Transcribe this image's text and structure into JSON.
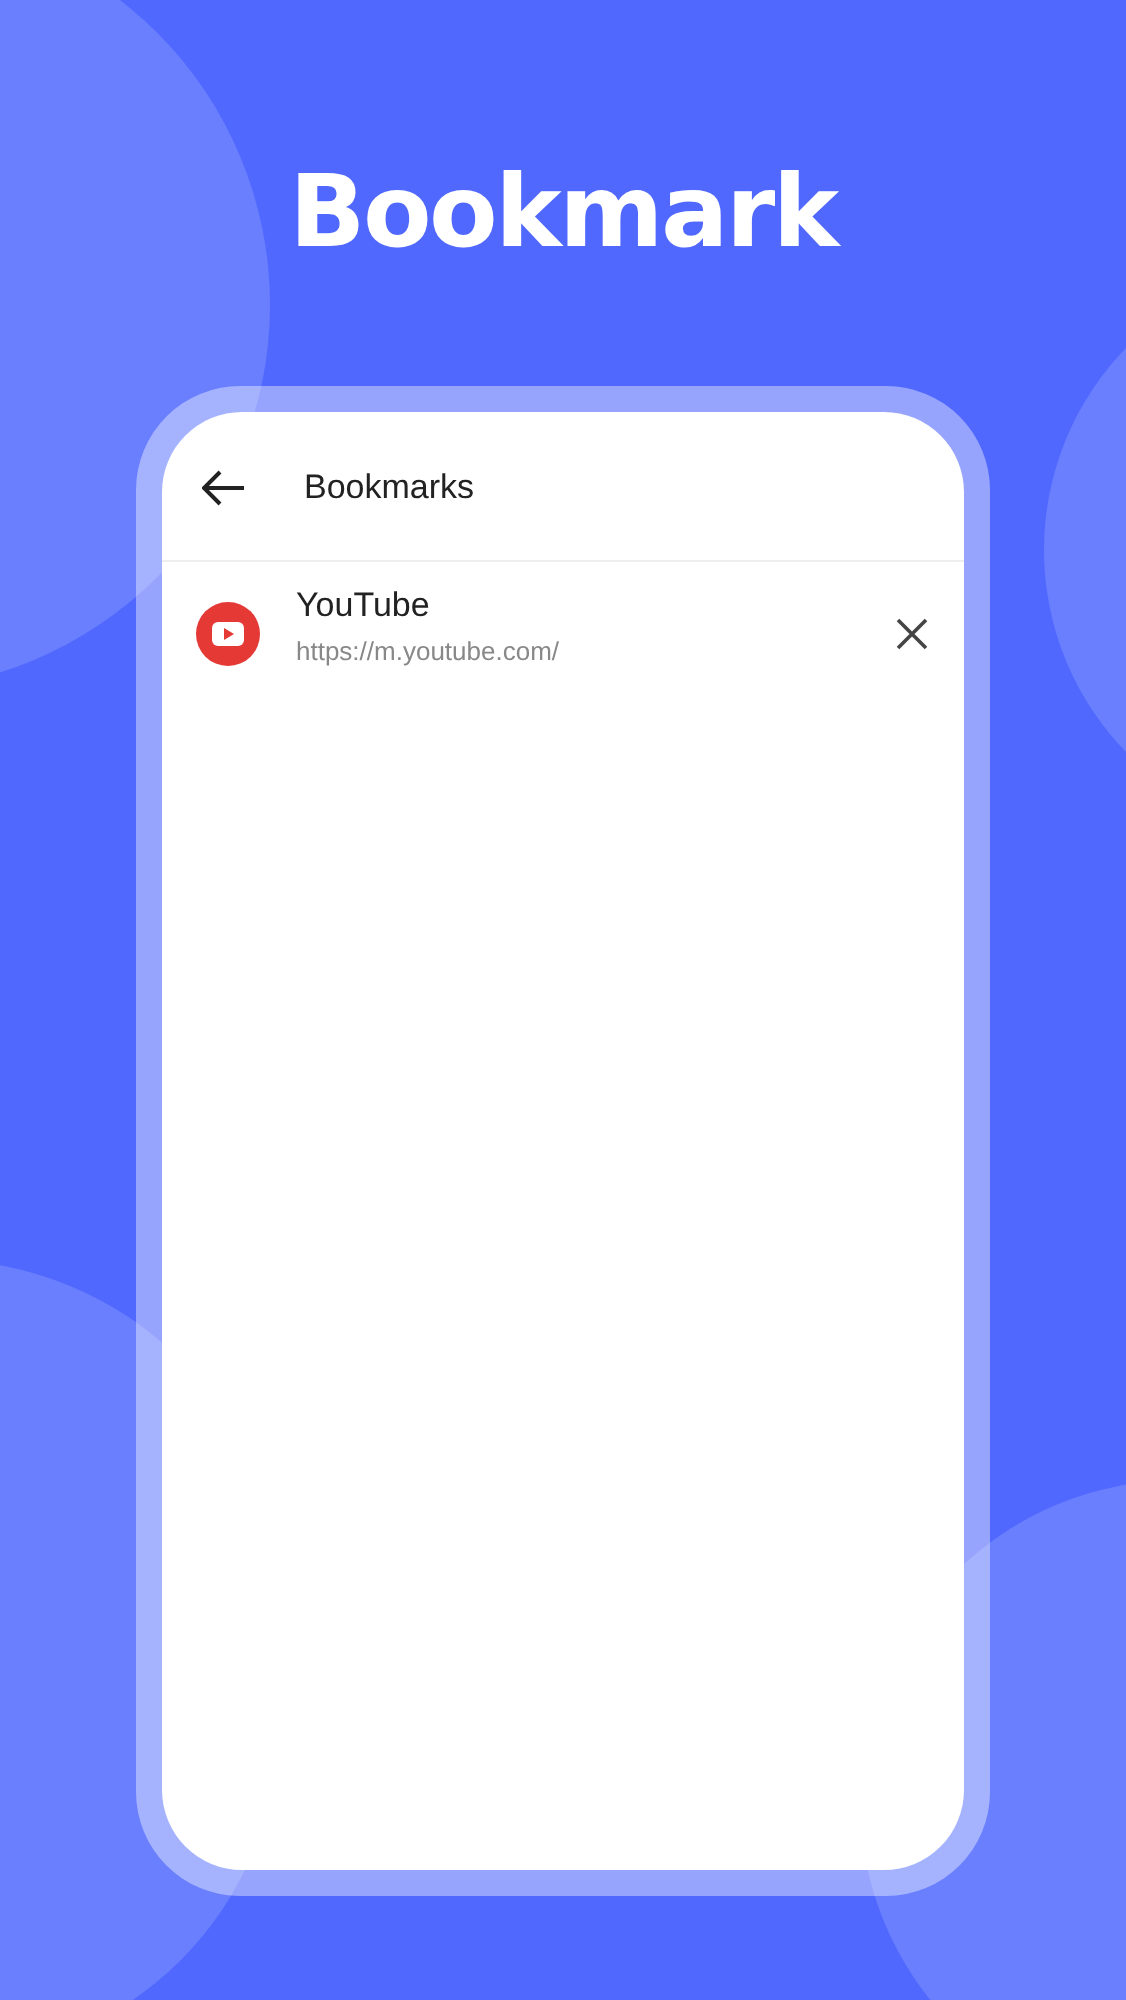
{
  "headline": "Bookmark",
  "screen": {
    "title": "Bookmarks",
    "bookmarks": [
      {
        "title": "YouTube",
        "url": "https://m.youtube.com/"
      }
    ]
  }
}
